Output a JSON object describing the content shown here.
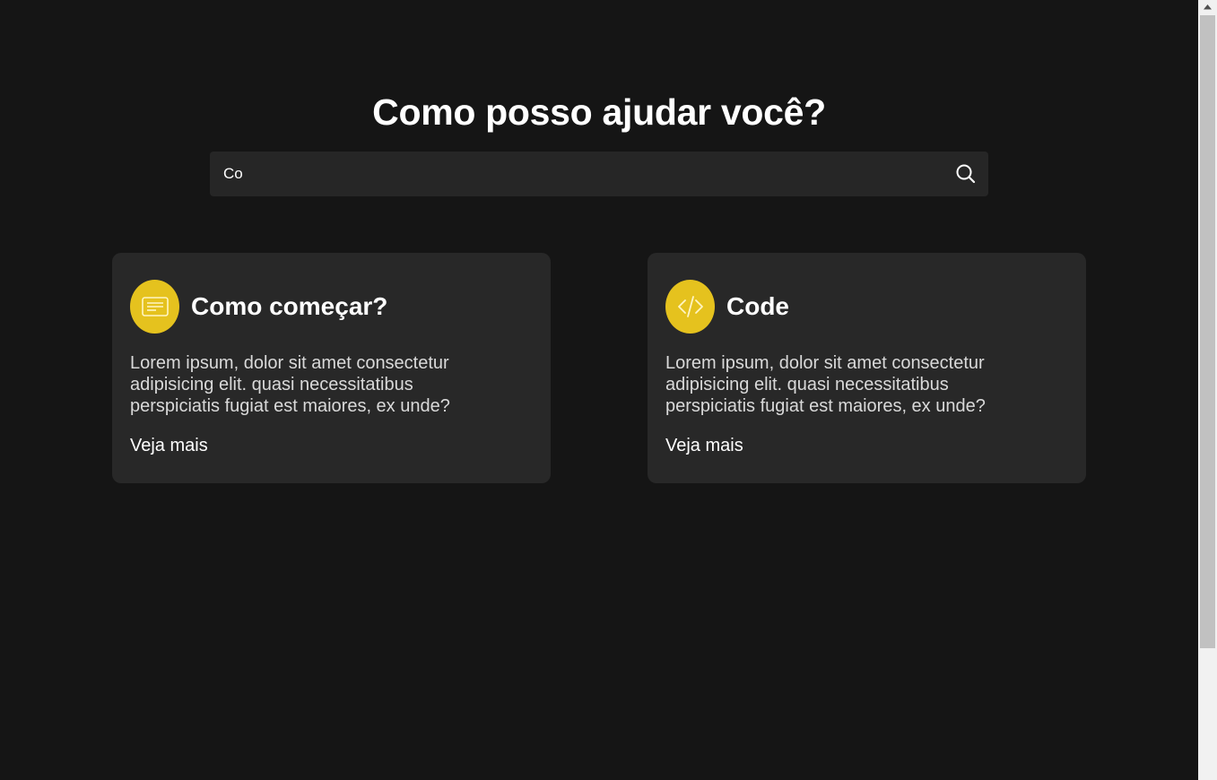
{
  "header": {
    "title": "Como posso ajudar você?"
  },
  "search": {
    "value": "Co",
    "icon": "search-icon"
  },
  "cards": [
    {
      "icon": "document-lines-icon",
      "title": "Como começar?",
      "text": "Lorem ipsum, dolor sit amet consectetur adipisicing elit. quasi necessitatibus perspiciatis fugiat est maiores, ex unde?",
      "link": "Veja mais"
    },
    {
      "icon": "code-icon",
      "title": "Code",
      "text": "Lorem ipsum, dolor sit amet consectetur adipisicing elit. quasi necessitatibus perspiciatis fugiat est maiores, ex unde?",
      "link": "Veja mais"
    }
  ],
  "colors": {
    "background": "#151515",
    "card": "#282828",
    "search": "#262626",
    "accent": "#e5c21e"
  }
}
